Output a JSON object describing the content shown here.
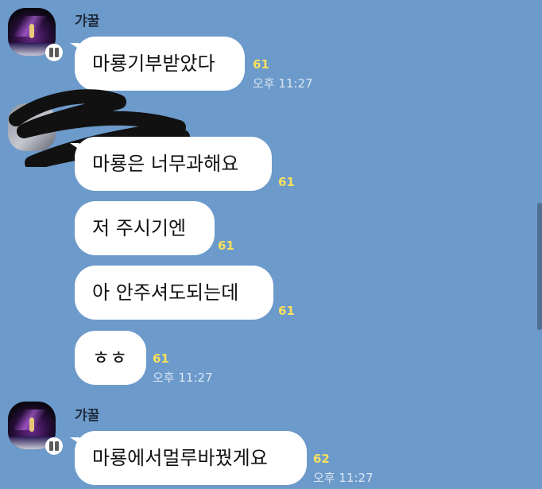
{
  "messages": {
    "group1": {
      "sender": "갸꿀",
      "items": [
        {
          "text": "마룡기부받았다",
          "unread": "61",
          "time": "오후 11:27"
        }
      ]
    },
    "group2": {
      "items": [
        {
          "text": "마룡은 너무과해요",
          "unread": "61"
        },
        {
          "text": "저 주시기엔",
          "unread": "61"
        },
        {
          "text": "아 안주셔도되는데",
          "unread": "61"
        },
        {
          "text": "ㅎㅎ",
          "unread": "61",
          "time": "오후 11:27"
        }
      ]
    },
    "group3": {
      "sender": "갸꿀",
      "items": [
        {
          "text": "마룡에서멀루바꿨게요",
          "unread": "62",
          "time": "오후 11:27"
        }
      ]
    }
  },
  "colors": {
    "background": "#6c9acb",
    "bubble": "#ffffff",
    "unread": "#f6e05e",
    "time": "#dbe6f3"
  },
  "icons": {
    "badge": "app-badge-icon"
  }
}
